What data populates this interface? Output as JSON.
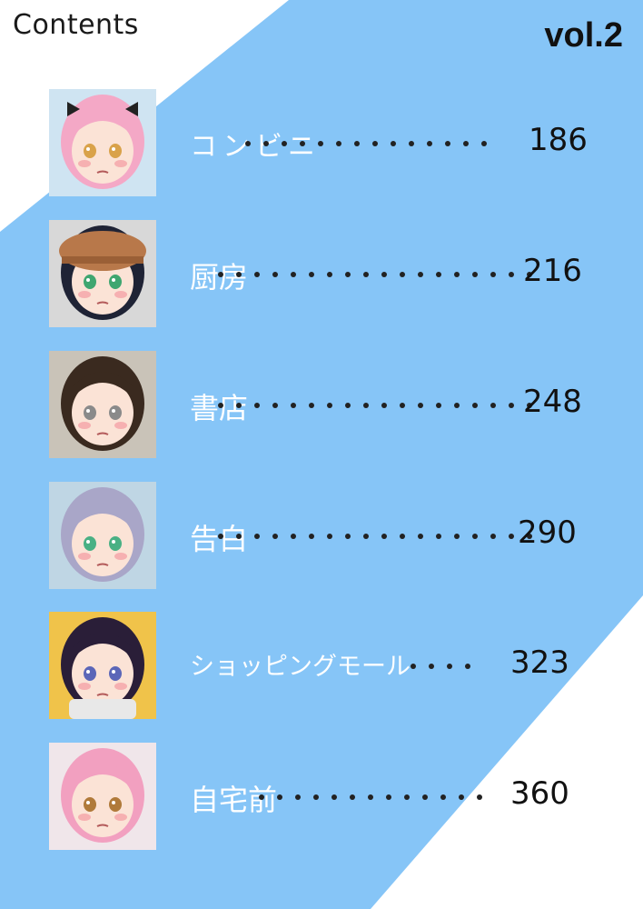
{
  "header": {
    "title": "Contents",
    "volume": "vol.2"
  },
  "colors": {
    "background": "#86c5f7",
    "text_light": "#ffffff",
    "text_dark": "#111111"
  },
  "entries": [
    {
      "title": "コンビニ",
      "page": "186",
      "thumb": {
        "hair": "#f4a8c6",
        "eyes": "#d9a24a",
        "bg": "#cfe4f2",
        "accessory": "bow"
      }
    },
    {
      "title": "厨房",
      "page": "216",
      "thumb": {
        "hair": "#1f2335",
        "eyes": "#3fa670",
        "bg": "#d8d8d8",
        "accessory": "cap"
      }
    },
    {
      "title": "書店",
      "page": "248",
      "thumb": {
        "hair": "#3a2a1f",
        "eyes": "#8a8a8a",
        "bg": "#c9c3b8",
        "accessory": "none"
      }
    },
    {
      "title": "告白",
      "page": "290",
      "thumb": {
        "hair": "#a9a6c8",
        "eyes": "#49b084",
        "bg": "#bfd6e4",
        "accessory": "none"
      }
    },
    {
      "title": "ショッピングモール",
      "page": "323",
      "thumb": {
        "hair": "#2a1e38",
        "eyes": "#5b66b8",
        "bg": "#f0c34a",
        "accessory": "scarf"
      }
    },
    {
      "title": "自宅前",
      "page": "360",
      "thumb": {
        "hair": "#f2a0c0",
        "eyes": "#b07a3a",
        "bg": "#f0e6ea",
        "accessory": "none"
      }
    }
  ]
}
